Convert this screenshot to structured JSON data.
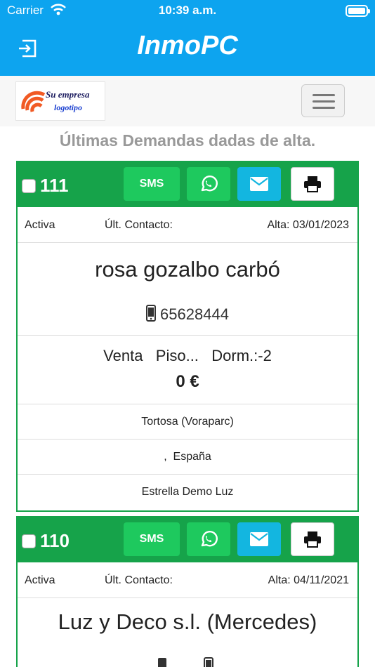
{
  "status_bar": {
    "carrier": "Carrier",
    "time": "10:39 a.m."
  },
  "app": {
    "title": "InmoPC"
  },
  "logo": {
    "line1": "Su empresa",
    "line2": "logotipo"
  },
  "heading": "Últimas Demandas dadas de alta.",
  "buttons": {
    "sms": "SMS"
  },
  "icons": [
    "wifi-icon",
    "battery-icon",
    "logout-icon",
    "hamburger-menu-icon",
    "whatsapp-icon",
    "mail-icon",
    "print-icon",
    "mobile-phone-icon"
  ],
  "colors": {
    "topbar": "#0da4ef",
    "card_green": "#16a34a",
    "button_green": "#1ec95e",
    "button_cyan": "#13b6e0"
  },
  "cards": [
    {
      "id": "111",
      "status": "Activa",
      "last_contact": "Últ. Contacto:",
      "alta": "Alta: 03/01/2023",
      "name": "rosa gozalbo carbó",
      "phone": "65628444",
      "operation": "Venta   Piso...   Dorm.:-2",
      "price": "0 €",
      "zone": "Tortosa (Voraparc)",
      "country": ",  España",
      "agent": "Estrella Demo Luz"
    },
    {
      "id": "110",
      "status": "Activa",
      "last_contact": "Últ. Contacto:",
      "alta": "Alta: 04/11/2021",
      "name": "Luz y Deco s.l. (Mercedes)",
      "phone_1": "",
      "phone_2": ""
    }
  ]
}
